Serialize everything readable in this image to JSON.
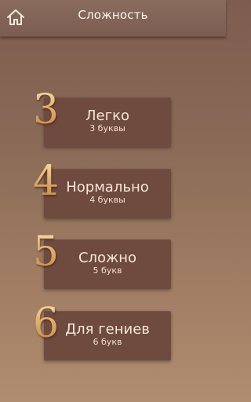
{
  "header": {
    "title": "Сложность",
    "home_icon": "home-icon"
  },
  "levels": [
    {
      "digit": "3",
      "name": "Легко",
      "sub": "3 буквы"
    },
    {
      "digit": "4",
      "name": "Нормально",
      "sub": "4 буквы"
    },
    {
      "digit": "5",
      "name": "Сложно",
      "sub": "5 букв"
    },
    {
      "digit": "6",
      "name": "Для гениев",
      "sub": "6 букв"
    }
  ],
  "colors": {
    "background_top": "#7e5c4f",
    "background_bottom": "#b08d70",
    "card": "#6f4a3f",
    "digit_gold": "#e0b473",
    "text_light": "#f5e6d6"
  }
}
